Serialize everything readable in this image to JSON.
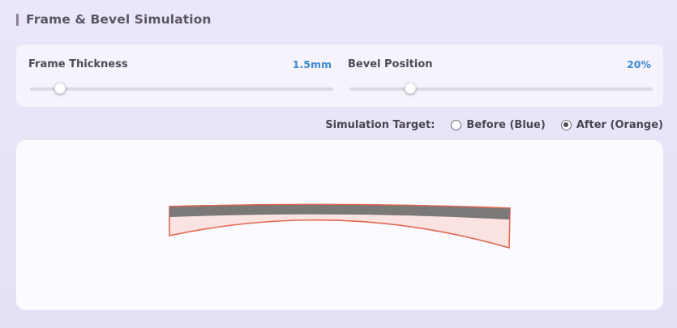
{
  "header": {
    "title": "Frame & Bevel Simulation"
  },
  "controls": {
    "frame_thickness": {
      "label": "Frame Thickness",
      "value_text": "1.5mm",
      "level": 0.1
    },
    "bevel_position": {
      "label": "Bevel Position",
      "value_text": "20%",
      "level": 0.2
    }
  },
  "simulation_target": {
    "label": "Simulation Target:",
    "options": [
      {
        "label": "Before (Blue)",
        "selected": false
      },
      {
        "label": "After (Orange)",
        "selected": true
      }
    ]
  },
  "colors": {
    "accent_value": "#3b8ad0",
    "lens_outline": "#e0684f",
    "lens_fill": "#fbe3e1",
    "frame_band": "#7b7878"
  }
}
